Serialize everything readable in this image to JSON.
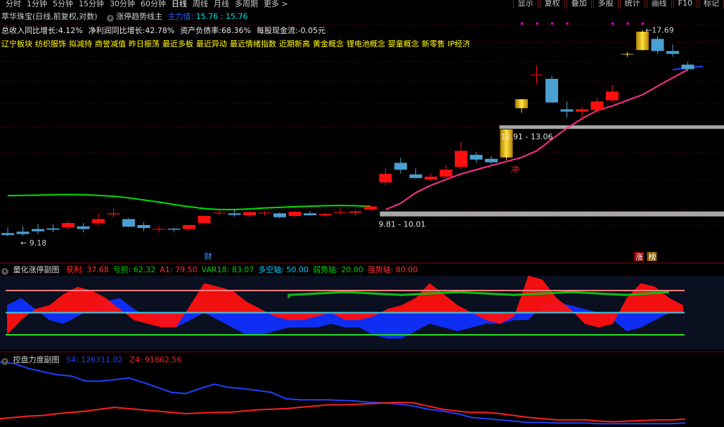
{
  "toolbar": {
    "timeframes": [
      "分时",
      "1分钟",
      "5分钟",
      "15分钟",
      "30分钟",
      "60分钟",
      "日线",
      "周线",
      "月线",
      "多周期",
      "更多 >"
    ],
    "active_timeframe": "日线",
    "buttons": [
      "显示",
      "复权",
      "叠加",
      "多股",
      "统计",
      "画线",
      "F10",
      "标记"
    ]
  },
  "header": {
    "stock_title": "萃华珠宝(日线,前复权,对数)",
    "indicator_name": "涨停趋势线主",
    "indicator_label": "主力值:",
    "indicator_value1": "15.76",
    "indicator_sep": ":",
    "indicator_value2": "15.76",
    "stats": [
      "总收入同比增长:4.12%",
      "净利润同比增长:42.78%",
      "资产负债率:68.36%",
      "每股现金流:-0.05元"
    ],
    "concepts": [
      "辽宁板块",
      "纺织服饰",
      "拟减持",
      "商誉减值",
      "昨日振荡",
      "最近多板",
      "最近异动",
      "最近情绪指数",
      "近期新高",
      "黄金概念",
      "锂电池概念",
      "婴童概念",
      "新零售",
      "IP经济"
    ]
  },
  "main_chart": {
    "type": "candlestick",
    "price_high_label": "17.69",
    "price_low_label": "9.18",
    "zone_lower_label": "9.81 - 10.01",
    "zone_upper_label": "12.91 - 13.06",
    "signal_label": "冲",
    "event_marks": [
      "财",
      "涨",
      "榜"
    ],
    "candles": [
      {
        "o": 9.28,
        "h": 9.45,
        "l": 9.18,
        "c": 9.22
      },
      {
        "o": 9.32,
        "h": 9.48,
        "l": 9.2,
        "c": 9.25
      },
      {
        "o": 9.4,
        "h": 9.55,
        "l": 9.25,
        "c": 9.33
      },
      {
        "o": 9.42,
        "h": 9.55,
        "l": 9.3,
        "c": 9.38
      },
      {
        "o": 9.45,
        "h": 9.65,
        "l": 9.38,
        "c": 9.58
      },
      {
        "o": 9.48,
        "h": 9.58,
        "l": 9.3,
        "c": 9.4
      },
      {
        "o": 9.58,
        "h": 9.88,
        "l": 9.5,
        "c": 9.7
      },
      {
        "o": 9.85,
        "h": 10.05,
        "l": 9.75,
        "c": 9.88
      },
      {
        "o": 9.7,
        "h": 9.73,
        "l": 9.45,
        "c": 9.47
      },
      {
        "o": 9.52,
        "h": 9.6,
        "l": 9.33,
        "c": 9.43
      },
      {
        "o": 9.4,
        "h": 9.5,
        "l": 9.3,
        "c": 9.4
      },
      {
        "o": 9.41,
        "h": 9.44,
        "l": 9.3,
        "c": 9.38
      },
      {
        "o": 9.4,
        "h": 9.5,
        "l": 9.34,
        "c": 9.52
      },
      {
        "o": 9.58,
        "h": 9.82,
        "l": 9.55,
        "c": 9.8
      },
      {
        "o": 9.9,
        "h": 10.05,
        "l": 9.82,
        "c": 9.9
      },
      {
        "o": 9.88,
        "h": 10.0,
        "l": 9.78,
        "c": 9.83
      },
      {
        "o": 9.82,
        "h": 9.95,
        "l": 9.76,
        "c": 9.92
      },
      {
        "o": 9.9,
        "h": 9.95,
        "l": 9.82,
        "c": 9.9
      },
      {
        "o": 9.88,
        "h": 9.92,
        "l": 9.72,
        "c": 9.76
      },
      {
        "o": 9.8,
        "h": 9.95,
        "l": 9.76,
        "c": 9.93
      },
      {
        "o": 9.88,
        "h": 9.95,
        "l": 9.8,
        "c": 9.82
      },
      {
        "o": 9.82,
        "h": 9.88,
        "l": 9.78,
        "c": 9.86
      },
      {
        "o": 9.9,
        "h": 10.05,
        "l": 9.85,
        "c": 9.92
      },
      {
        "o": 9.9,
        "h": 10.0,
        "l": 9.8,
        "c": 9.94
      },
      {
        "o": 10.0,
        "h": 10.15,
        "l": 9.95,
        "c": 10.1
      },
      {
        "o": 10.9,
        "h": 11.4,
        "l": 10.8,
        "c": 11.2
      },
      {
        "o": 11.6,
        "h": 11.8,
        "l": 11.2,
        "c": 11.35
      },
      {
        "o": 11.18,
        "h": 11.4,
        "l": 11.05,
        "c": 11.05
      },
      {
        "o": 11.0,
        "h": 11.2,
        "l": 10.95,
        "c": 11.1
      },
      {
        "o": 11.1,
        "h": 11.5,
        "l": 11.05,
        "c": 11.35
      },
      {
        "o": 11.45,
        "h": 12.4,
        "l": 11.35,
        "c": 12.05
      },
      {
        "o": 11.9,
        "h": 12.0,
        "l": 11.6,
        "c": 11.72
      },
      {
        "o": 11.75,
        "h": 11.85,
        "l": 11.55,
        "c": 11.62
      },
      {
        "o": 11.8,
        "h": 12.9,
        "l": 11.7,
        "c": 12.9
      },
      {
        "o": 13.8,
        "h": 14.2,
        "l": 13.6,
        "c": 14.2
      },
      {
        "o": 15.35,
        "h": 15.8,
        "l": 14.9,
        "c": 15.35
      },
      {
        "o": 15.15,
        "h": 15.3,
        "l": 14.05,
        "c": 14.05
      },
      {
        "o": 13.75,
        "h": 14.1,
        "l": 13.4,
        "c": 13.65
      },
      {
        "o": 13.65,
        "h": 13.85,
        "l": 13.3,
        "c": 13.75
      },
      {
        "o": 13.72,
        "h": 14.25,
        "l": 13.6,
        "c": 14.1
      },
      {
        "o": 14.15,
        "h": 14.85,
        "l": 14.05,
        "c": 14.55
      },
      {
        "o": 16.4,
        "h": 16.5,
        "l": 16.25,
        "c": 16.4
      },
      {
        "o": 16.6,
        "h": 17.69,
        "l": 16.6,
        "c": 17.6
      },
      {
        "o": 17.2,
        "h": 17.35,
        "l": 16.4,
        "c": 16.55
      },
      {
        "o": 16.55,
        "h": 16.9,
        "l": 16.25,
        "c": 16.4
      },
      {
        "o": 15.85,
        "h": 16.0,
        "l": 15.55,
        "c": 15.62
      }
    ],
    "limit_up_gold_indices": [
      33,
      34,
      41,
      42
    ],
    "ma_green": [
      10.45,
      10.46,
      10.47,
      10.48,
      10.49,
      10.48,
      10.46,
      10.43,
      10.38,
      10.31,
      10.24,
      10.16,
      10.09,
      10.03,
      10.0,
      10.0,
      10.02,
      10.05,
      10.07,
      10.09,
      10.11,
      10.12,
      10.13,
      10.12,
      10.1
    ],
    "ma_green_start": 0,
    "ma_pink": [
      10.0,
      10.2,
      10.55,
      10.8,
      11.0,
      11.2,
      11.35,
      11.5,
      11.65,
      11.8,
      12.05,
      12.5,
      12.95,
      13.35,
      13.7,
      13.9,
      14.15,
      14.4,
      14.8,
      15.2,
      15.6
    ],
    "ma_pink_start": 25,
    "ma_blue": [
      15.6,
      15.7,
      15.76
    ],
    "ma_blue_start": 44
  },
  "sub_panel1": {
    "name": "量化涨停副图",
    "labels": [
      {
        "text": "获利: 37.68",
        "color": "#ff3030"
      },
      {
        "text": "亏损: 62.32",
        "color": "#00d000"
      },
      {
        "text": "A1: 79.50",
        "color": "#ff3030"
      },
      {
        "text": "VAR18: 83.07",
        "color": "#00d000"
      },
      {
        "text": "多空轴: 50.00",
        "color": "#00c8ff"
      },
      {
        "text": "弱势轴: 20.00",
        "color": "#00d000"
      },
      {
        "text": "强势轴: 80.00",
        "color": "#ff3030"
      }
    ],
    "axis_levels": {
      "strong": 80,
      "mid": 50,
      "weak": 20
    },
    "red_area": [
      20,
      40,
      55,
      60,
      75,
      85,
      80,
      70,
      55,
      40,
      35,
      30,
      30,
      60,
      90,
      85,
      80,
      65,
      55,
      45,
      40,
      40,
      45,
      50,
      40,
      40,
      45,
      55,
      60,
      70,
      90,
      75,
      60,
      50,
      40,
      35,
      45,
      100,
      95,
      70,
      55,
      35,
      30,
      35,
      70,
      90,
      85,
      70,
      60
    ],
    "blue_area": [
      60,
      70,
      55,
      40,
      35,
      45,
      55,
      65,
      70,
      55,
      45,
      35,
      30,
      40,
      50,
      40,
      30,
      20,
      20,
      25,
      30,
      30,
      30,
      35,
      30,
      30,
      20,
      15,
      15,
      25,
      35,
      30,
      25,
      30,
      35,
      35,
      40,
      40,
      60,
      65,
      60,
      55,
      50,
      40,
      25,
      30,
      40,
      50,
      55
    ]
  },
  "sub_panel2": {
    "name": "控盘力度副图",
    "s4_label": "S4: 126311.02",
    "z4_label": "Z4: 91862.56",
    "s4_color": "#2040ff",
    "z4_color": "#ff2020",
    "s4_line": [
      100,
      98,
      90,
      85,
      80,
      78,
      70,
      70,
      72,
      75,
      68,
      60,
      52,
      50,
      58,
      65,
      60,
      58,
      55,
      52,
      42,
      40,
      40,
      40,
      39,
      38,
      36,
      35,
      33,
      30,
      25,
      22,
      18,
      12,
      10,
      8,
      6,
      4,
      4,
      3,
      3,
      3,
      2,
      2,
      2,
      2,
      2,
      2,
      3
    ],
    "z4_line": [
      10,
      12,
      14,
      15,
      18,
      20,
      22,
      25,
      28,
      26,
      24,
      22,
      20,
      18,
      19,
      20,
      20,
      22,
      24,
      25,
      26,
      28,
      30,
      32,
      32,
      33,
      34,
      35,
      36,
      35,
      30,
      25,
      22,
      20,
      20,
      18,
      15,
      12,
      10,
      8,
      8,
      8,
      6,
      5,
      6,
      7,
      8,
      8,
      9
    ]
  }
}
